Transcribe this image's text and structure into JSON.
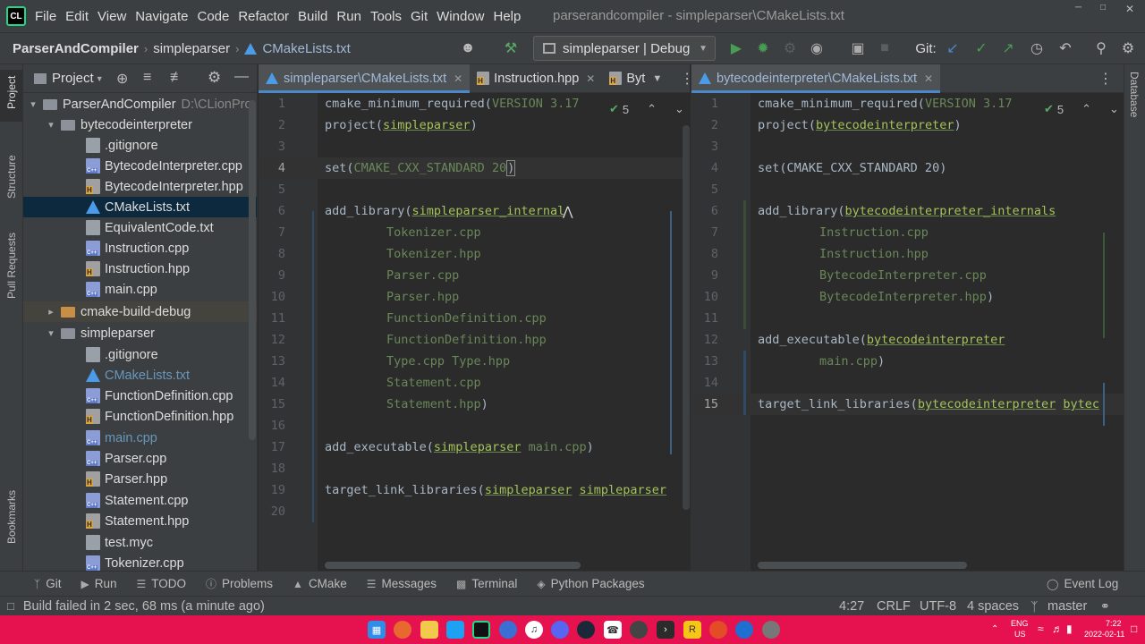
{
  "menu": {
    "items": [
      "File",
      "Edit",
      "View",
      "Navigate",
      "Code",
      "Refactor",
      "Build",
      "Run",
      "Tools",
      "Git",
      "Window",
      "Help"
    ],
    "window_title": "parserandcompiler - simpleparser\\CMakeLists.txt"
  },
  "navbar": {
    "crumbs": [
      "ParserAndCompiler",
      "simpleparser",
      "CMakeLists.txt"
    ],
    "run_config": "simpleparser | Debug",
    "git_label": "Git:"
  },
  "project_panel": {
    "title": "Project",
    "rows": [
      {
        "label": "ParserAndCompiler",
        "hint": "D:\\CLionPro",
        "type": "folder"
      },
      {
        "label": "bytecodeinterpreter",
        "type": "folder"
      },
      {
        "label": ".gitignore",
        "type": "git"
      },
      {
        "label": "BytecodeInterpreter.cpp",
        "type": "cpp"
      },
      {
        "label": "BytecodeInterpreter.hpp",
        "type": "hpp"
      },
      {
        "label": "CMakeLists.txt",
        "type": "cmake"
      },
      {
        "label": "EquivalentCode.txt",
        "type": "txt"
      },
      {
        "label": "Instruction.cpp",
        "type": "cpp"
      },
      {
        "label": "Instruction.hpp",
        "type": "hpp"
      },
      {
        "label": "main.cpp",
        "type": "cpp"
      },
      {
        "label": "cmake-build-debug",
        "type": "folder-orange"
      },
      {
        "label": "simpleparser",
        "type": "folder"
      },
      {
        "label": ".gitignore",
        "type": "git"
      },
      {
        "label": "CMakeLists.txt",
        "type": "cmake"
      },
      {
        "label": "FunctionDefinition.cpp",
        "type": "cpp"
      },
      {
        "label": "FunctionDefinition.hpp",
        "type": "hpp"
      },
      {
        "label": "main.cpp",
        "type": "cpp"
      },
      {
        "label": "Parser.cpp",
        "type": "cpp"
      },
      {
        "label": "Parser.hpp",
        "type": "hpp"
      },
      {
        "label": "Statement.cpp",
        "type": "cpp"
      },
      {
        "label": "Statement.hpp",
        "type": "hpp"
      },
      {
        "label": "test.myc",
        "type": "myc"
      },
      {
        "label": "Tokenizer.cpp",
        "type": "cpp"
      }
    ]
  },
  "stripes": {
    "left_top": [
      "Project",
      "Structure",
      "Pull Requests"
    ],
    "left_bottom": "Bookmarks",
    "right": "Database"
  },
  "left_editor": {
    "tabs": [
      "simpleparser\\CMakeLists.txt",
      "Instruction.hpp",
      "Byt"
    ],
    "inspection_count": "5",
    "line_numbers": [
      "1",
      "2",
      "3",
      "4",
      "5",
      "6",
      "7",
      "8",
      "9",
      "10",
      "11",
      "12",
      "13",
      "14",
      "15",
      "16",
      "17",
      "18",
      "19",
      "20"
    ],
    "current_line": "4",
    "lines": {
      "l1_fn": "cmake_minimum_required(",
      "l1_arg": "VERSION 3.17",
      "l2_fn": "project(",
      "l2_arg": "simpleparser",
      "l2_end": ")",
      "l4_fn": "set(",
      "l4_arg": "CMAKE_CXX_STANDARD 20",
      "l4_end": ")",
      "l6_fn": "add_library(",
      "l6_arg": "simpleparser_internal",
      "l7": "Tokenizer.cpp",
      "l8": "Tokenizer.hpp",
      "l9": "Parser.cpp",
      "l10": "Parser.hpp",
      "l11": "FunctionDefinition.cpp",
      "l12": "FunctionDefinition.hpp",
      "l13": "Type.cpp Type.hpp",
      "l14": "Statement.cpp",
      "l15": "Statement.hpp",
      "l15_end": ")",
      "l17_fn": "add_executable(",
      "l17_arg": "simpleparser",
      "l17_rest": " main.cpp",
      "l17_end": ")",
      "l19_fn": "target_link_libraries(",
      "l19_arg": "simpleparser",
      "l19_arg2": "simpleparser"
    }
  },
  "right_editor": {
    "tabs": [
      "bytecodeinterpreter\\CMakeLists.txt"
    ],
    "inspection_count": "5",
    "line_numbers": [
      "1",
      "2",
      "3",
      "4",
      "5",
      "6",
      "7",
      "8",
      "9",
      "10",
      "11",
      "12",
      "13",
      "14",
      "15"
    ],
    "current_line": "15",
    "lines": {
      "l1_fn": "cmake_minimum_required(",
      "l1_arg": "VERSION 3.17",
      "l2_fn": "project(",
      "l2_arg": "bytecodeinterpreter",
      "l2_end": ")",
      "l4": "set(CMAKE_CXX_STANDARD 20)",
      "l6_fn": "add_library(",
      "l6_arg": "bytecodeinterpreter_internals",
      "l7": "Instruction.cpp",
      "l8": "Instruction.hpp",
      "l9": "BytecodeInterpreter.cpp",
      "l10": "BytecodeInterpreter.hpp",
      "l10_end": ")",
      "l12_fn": "add_executable(",
      "l12_arg": "bytecodeinterpreter",
      "l13": "main.cpp",
      "l13_end": ")",
      "l15_fn": "target_link_libraries(",
      "l15_arg": "bytecodeinterpreter",
      "l15_arg2": "bytec"
    }
  },
  "tool_windows": [
    "Git",
    "Run",
    "TODO",
    "Problems",
    "CMake",
    "Messages",
    "Terminal",
    "Python Packages"
  ],
  "event_log": "Event Log",
  "status": {
    "message": "Build failed in 2 sec, 68 ms (a minute ago)",
    "position": "4:27",
    "line_sep": "CRLF",
    "encoding": "UTF-8",
    "indent": "4 spaces",
    "branch": "master"
  },
  "taskbar": {
    "lang": "ENG",
    "region": "US",
    "time": "7:22",
    "date": "2022-02-11"
  },
  "colors": {
    "accent": "#4a88c7",
    "taskbar": "#e6124f",
    "run_green": "#499c54"
  }
}
